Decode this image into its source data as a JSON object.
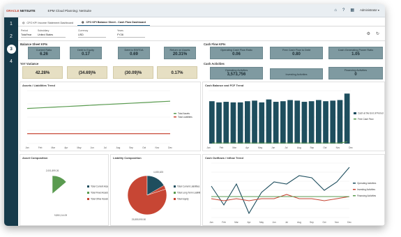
{
  "app": {
    "logo_oracle": "ORACLE",
    "logo_netsuite": "NETSUITE",
    "title": "EPM Cloud Planning: NetSuite",
    "admin": "Administrator ▾"
  },
  "rail": [
    "1",
    "2",
    "3",
    "4"
  ],
  "tabs": [
    "CFO KPI Income Statement Dashboard",
    "CFO KPI Balance Sheet - Cash Flow Dashboard"
  ],
  "pov": [
    {
      "label": "Period",
      "value": "TotalYear"
    },
    {
      "label": "Subsidiary",
      "value": "United States"
    },
    {
      "label": "Currency",
      "value": "USD"
    },
    {
      "label": "Years",
      "value": "FY28"
    }
  ],
  "sections": {
    "bs_kpis": "Balance Sheet KPIs",
    "cf_kpis": "Cash Flow KPIs",
    "yoy": "YoY Variance",
    "cash_act": "Cash Activities"
  },
  "bs_kpis": [
    {
      "label": "Current Ratio",
      "value": "6.26"
    },
    {
      "label": "Debt to Equity",
      "value": "0.17"
    },
    {
      "label": "Debt to EBITDA",
      "value": "0.69"
    },
    {
      "label": "Return on Assets",
      "value": "20.31%"
    }
  ],
  "cf_kpis": [
    {
      "label": "Operating Cash Flow Ratio",
      "value": "0.06"
    },
    {
      "label": "Free Cash Flow to Debt",
      "value": "0.80"
    },
    {
      "label": "Cash Generating Power Ratio",
      "value": "1.05"
    }
  ],
  "yoy": [
    "42.28%",
    "(34.69)%",
    "(30.09)%",
    "0.17%"
  ],
  "cash_act": [
    {
      "label": "Operating Activities",
      "value": "3,573,756"
    },
    {
      "label": "Investing Activities",
      "value": ""
    },
    {
      "label": "Financing Activities",
      "value": "0"
    }
  ],
  "panels": {
    "assets": "Assets / Liabilities Trend",
    "cashbal": "Cash Balance and FCF Trend",
    "assetcomp": "Asset Composition",
    "liabcomp": "Liability Composition",
    "cashflow": "Cash Outflows / Inflow Trend"
  },
  "months": [
    "Jan",
    "Feb",
    "Mar",
    "Apr",
    "May",
    "Jun",
    "Jul",
    "Aug",
    "Sep",
    "Oct",
    "Nov",
    "Dec"
  ],
  "chart_data": [
    {
      "type": "line",
      "title": "Assets / Liabilities Trend",
      "categories": [
        "Jan",
        "Feb",
        "Mar",
        "Apr",
        "May",
        "Jun",
        "Jul",
        "Aug",
        "Sep",
        "Oct",
        "Nov",
        "Dec"
      ],
      "series": [
        {
          "name": "Total Assets",
          "values": [
            53,
            54,
            55,
            56,
            57,
            58,
            59,
            60,
            61,
            62,
            63,
            64
          ]
        },
        {
          "name": "Total Liabilities",
          "values": [
            15,
            15,
            15,
            15,
            15,
            15,
            15,
            15,
            15,
            15,
            15,
            15
          ]
        }
      ],
      "ylim": [
        0,
        80
      ]
    },
    {
      "type": "bar",
      "title": "Cash Balance and FCF Trend",
      "categories": [
        "Jan",
        "Feb",
        "Mar",
        "Apr",
        "May",
        "Jun",
        "Jul",
        "Aug",
        "Sep",
        "Oct",
        "Nov",
        "Dec",
        "",
        "",
        "",
        "",
        "",
        "",
        "",
        ""
      ],
      "series": [
        {
          "name": "Cash at the End of Period",
          "values": [
            72,
            70,
            71,
            70,
            70,
            72,
            73,
            70,
            75,
            71,
            72,
            74,
            73,
            71,
            72,
            74,
            72,
            73,
            74,
            85
          ]
        },
        {
          "name": "Free Cash Flow",
          "values": [
            1,
            1,
            1,
            1,
            1,
            1,
            1,
            1,
            1,
            1,
            1,
            1,
            1,
            1,
            1,
            1,
            1,
            1,
            1,
            3
          ]
        }
      ],
      "ylim": [
        0,
        90
      ]
    },
    {
      "type": "pie",
      "title": "Asset Composition",
      "slices": [
        {
          "label": "Total Current Assets",
          "value": 2001899,
          "color": "#2a5f73"
        },
        {
          "label": "Total Fixed Assets",
          "value": 4000000,
          "color": "#2a5f73"
        },
        {
          "label": "Total Other Assets",
          "value": 0,
          "color": "#c74634"
        }
      ],
      "annotations": [
        "2,001,899.26",
        "9,850,114.09"
      ],
      "legend": [
        "Total Current Assets",
        "Total Fixed Assets",
        "Total Other Assets"
      ]
    },
    {
      "type": "pie",
      "title": "Liability Composition",
      "slices": [
        {
          "label": "Total Liabilities",
          "value": 20,
          "color": "#2a5f73"
        },
        {
          "label": "Total Equity",
          "value": 80,
          "color": "#c74634"
        }
      ],
      "annotations": [
        "4,455,625",
        "25,859,990.50"
      ],
      "legend": [
        "Total Current Liabilities",
        "Total Long Term Liabilities",
        "Total Equity"
      ]
    },
    {
      "type": "line",
      "title": "Cash Outflows / Inflow Trend",
      "categories": [
        "Jan",
        "Feb",
        "Mar",
        "Apr",
        "May",
        "Jun",
        "Jul",
        "Aug",
        "Sep",
        "Oct",
        "Nov",
        "Dec"
      ],
      "series": [
        {
          "name": "Operating Activities",
          "values": [
            5,
            -4,
            6,
            -8,
            2,
            7,
            6,
            10,
            9,
            3,
            7,
            14
          ]
        },
        {
          "name": "Investing Activities",
          "values": [
            -1,
            -2,
            -1,
            -2,
            -1,
            -1,
            1,
            -1,
            -1,
            -2,
            -1,
            0
          ]
        },
        {
          "name": "Financing Activities",
          "values": [
            0,
            0,
            0,
            0,
            0,
            0,
            0,
            0,
            0,
            0,
            0,
            0
          ]
        }
      ],
      "ylim": [
        -10,
        16
      ]
    }
  ]
}
